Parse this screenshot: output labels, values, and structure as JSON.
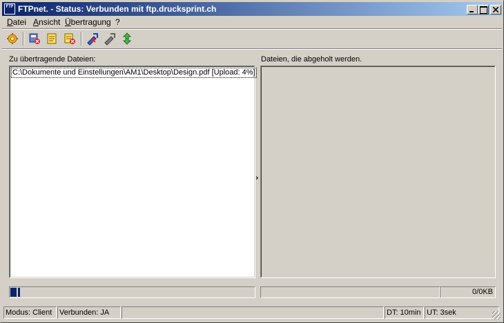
{
  "window": {
    "app_icon_text": "FTP",
    "title": "FTPnet. - Status: Verbunden mit ftp.drucksprint.ch"
  },
  "menu": [
    "Datei",
    "Ansicht",
    "Übertragung",
    "?"
  ],
  "toolbar": {
    "buttons": [
      "settings-icon",
      "disconnect-icon",
      "log-icon",
      "remove-file-icon",
      "stop-upload-icon",
      "pause-icon",
      "transfer-icon"
    ]
  },
  "left_panel": {
    "label": "Zu übertragende Dateien:",
    "items": [
      "C:\\Dokumente und Einstellungen\\AM1\\Desktop\\Design.pdf [Upload: 4%]"
    ],
    "progress": 0.04
  },
  "right_panel": {
    "label": "Dateien, die abgeholt werden.",
    "size_text": "0/0KB"
  },
  "statusbar": {
    "mode": "Modus: Client",
    "connected": "Verbunden: JA",
    "dt": "DT: 10min",
    "ut": "UT: 3sek"
  }
}
